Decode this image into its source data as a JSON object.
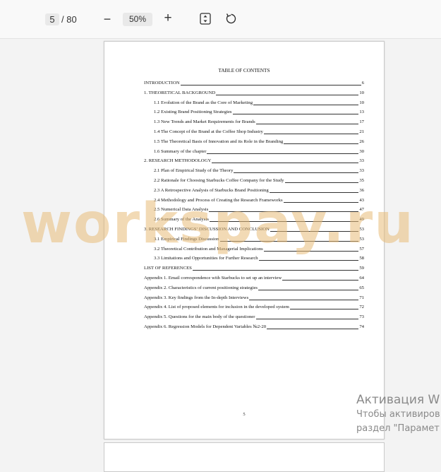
{
  "toolbar": {
    "current_page": "5",
    "total_pages": "/ 80",
    "zoom_level": "50%",
    "zoom_out_glyph": "−",
    "zoom_in_glyph": "+",
    "icons": [
      "fit-page-icon",
      "rotate-icon"
    ]
  },
  "document": {
    "toc_title": "TABLE OF CONTENTS",
    "entries": [
      {
        "text": "INTRODUCTION",
        "page": "6"
      },
      {
        "text": "1.    THEORETICAL BACKGROUND",
        "page": "10"
      },
      {
        "text": "1.1  Evolution of the Brand as the Core of Marketing",
        "page": "10"
      },
      {
        "text": "1.2  Existing Brand Positioning Strategies",
        "page": "13"
      },
      {
        "text": "1.3  New Trends and Market Requirements for Brands",
        "page": "17"
      },
      {
        "text": "1.4  The Concept of the Brand at the Coffee Shop Industry",
        "page": "21"
      },
      {
        "text": "1.5  The Theoretical Basis of Innovation and its Role in the Branding",
        "page": "26"
      },
      {
        "text": "1.6  Summary of the chapter",
        "page": "30"
      },
      {
        "text": "2.    RESEARCH METHODOLOGY",
        "page": "33"
      },
      {
        "text": "2.1  Plan of Empirical Study of the Theory",
        "page": "33"
      },
      {
        "text": "2.2  Rationale for Choosing Starbucks Coffee Company for the Study",
        "page": "35"
      },
      {
        "text": "2.3  A Retrospective Analysis of Starbucks Brand Positioning",
        "page": "36"
      },
      {
        "text": "2.4  Methodology and Process of Creating the Research Frameworks",
        "page": "43"
      },
      {
        "text": "2.5  Numerical Data Analysis",
        "page": "47"
      },
      {
        "text": "2.6  Summary of the Analysis",
        "page": "49"
      },
      {
        "text": "3.    RESEARCH FINDINGS’ DISCUSSION AND CONCLUSION",
        "page": "53"
      },
      {
        "text": "3.1  Empirical Findings Discussion",
        "page": "53"
      },
      {
        "text": "3.2  Theoretical Contribution and Managerial Implications",
        "page": "57"
      },
      {
        "text": "3.3  Limitations and Opportunities for Further Research",
        "page": "58"
      },
      {
        "text": "LIST OF REFERENCES",
        "page": "59"
      },
      {
        "text": "Appendix 1. Email correspondence with Starbucks to set up an interview",
        "page": "64"
      },
      {
        "text": "Appendix 2. Characteristics of current positioning strategies",
        "page": "65"
      },
      {
        "text": "Appendix 3. Key findings from the In-depth Interviews",
        "page": "71"
      },
      {
        "text": "Appendix 4. List of proposed elements for inclusion in the developed system",
        "page": "72"
      },
      {
        "text": "Appendix 5. Questions for the main body of the questioner",
        "page": "73"
      },
      {
        "text": "Appendix 6. Regression Models for Dependent Variables №2-20",
        "page": "74"
      }
    ],
    "page_number": "5"
  },
  "watermark_text": "workspay.ru",
  "activation": {
    "title": "Активация W",
    "line1": "Чтобы активиров",
    "line2": "раздел \"Парамет"
  }
}
